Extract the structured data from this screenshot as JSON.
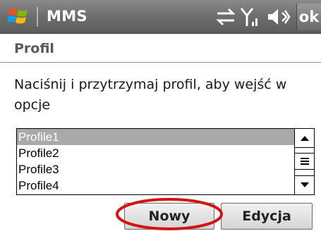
{
  "titlebar": {
    "app_title": "MMS",
    "ok_label": "ok",
    "icons": [
      "windows-start-icon",
      "connectivity-icon",
      "signal-icon",
      "volume-icon"
    ]
  },
  "section": {
    "title": "Profil"
  },
  "instruction": "Naciśnij i przytrzymaj profil, aby wejść w opcje",
  "profiles": {
    "items": [
      "Profile1",
      "Profile2",
      "Profile3",
      "Profile4"
    ],
    "selected": "Profile1"
  },
  "buttons": {
    "new_label": "Nowy",
    "edit_label": "Edycja"
  },
  "colors": {
    "annotation_ring": "#d21414",
    "selection": "#a9a9a9"
  }
}
